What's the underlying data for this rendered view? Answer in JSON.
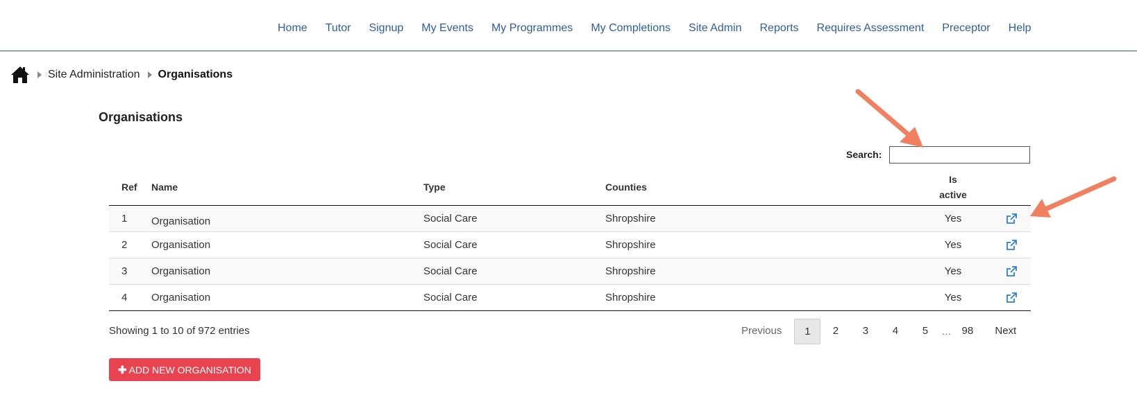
{
  "nav": {
    "items": [
      "Home",
      "Tutor",
      "Signup",
      "My Events",
      "My Programmes",
      "My Completions",
      "Site Admin",
      "Reports",
      "Requires Assessment",
      "Preceptor",
      "Help"
    ]
  },
  "breadcrumb": {
    "home_icon": "home-icon",
    "items": [
      "Site Administration"
    ],
    "current": "Organisations"
  },
  "page": {
    "title": "Organisations"
  },
  "search": {
    "label": "Search:",
    "value": "",
    "placeholder": ""
  },
  "table": {
    "columns": {
      "ref": "Ref",
      "name": "Name",
      "type": "Type",
      "counties": "Counties",
      "active_line1": "Is",
      "active_line2": "active"
    },
    "rows": [
      {
        "ref": "1",
        "name": "Organisation",
        "type": "Social Care",
        "counties": "Shropshire",
        "active": "Yes",
        "icon": "external-link-icon"
      },
      {
        "ref": "2",
        "name": "Organisation",
        "type": "Social Care",
        "counties": "Shropshire",
        "active": "Yes",
        "icon": "external-link-icon"
      },
      {
        "ref": "3",
        "name": "Organisation",
        "type": "Social Care",
        "counties": "Shropshire",
        "active": "Yes",
        "icon": "external-link-icon"
      },
      {
        "ref": "4",
        "name": "Organisation",
        "type": "Social Care",
        "counties": "Shropshire",
        "active": "Yes",
        "icon": "external-link-icon"
      }
    ]
  },
  "footer": {
    "info": "Showing 1 to 10 of 972 entries",
    "pagination": {
      "previous": "Previous",
      "pages": [
        "1",
        "2",
        "3",
        "4",
        "5"
      ],
      "ellipsis": "…",
      "last": "98",
      "next": "Next",
      "current": "1"
    },
    "add_button": {
      "icon": "plus-icon",
      "label": "ADD NEW ORGANISATION"
    }
  },
  "colors": {
    "nav_link": "#2f5d9e",
    "accent_button": "#e8434f",
    "annotation_arrow": "#f08060",
    "external_link": "#2f7fd1"
  }
}
